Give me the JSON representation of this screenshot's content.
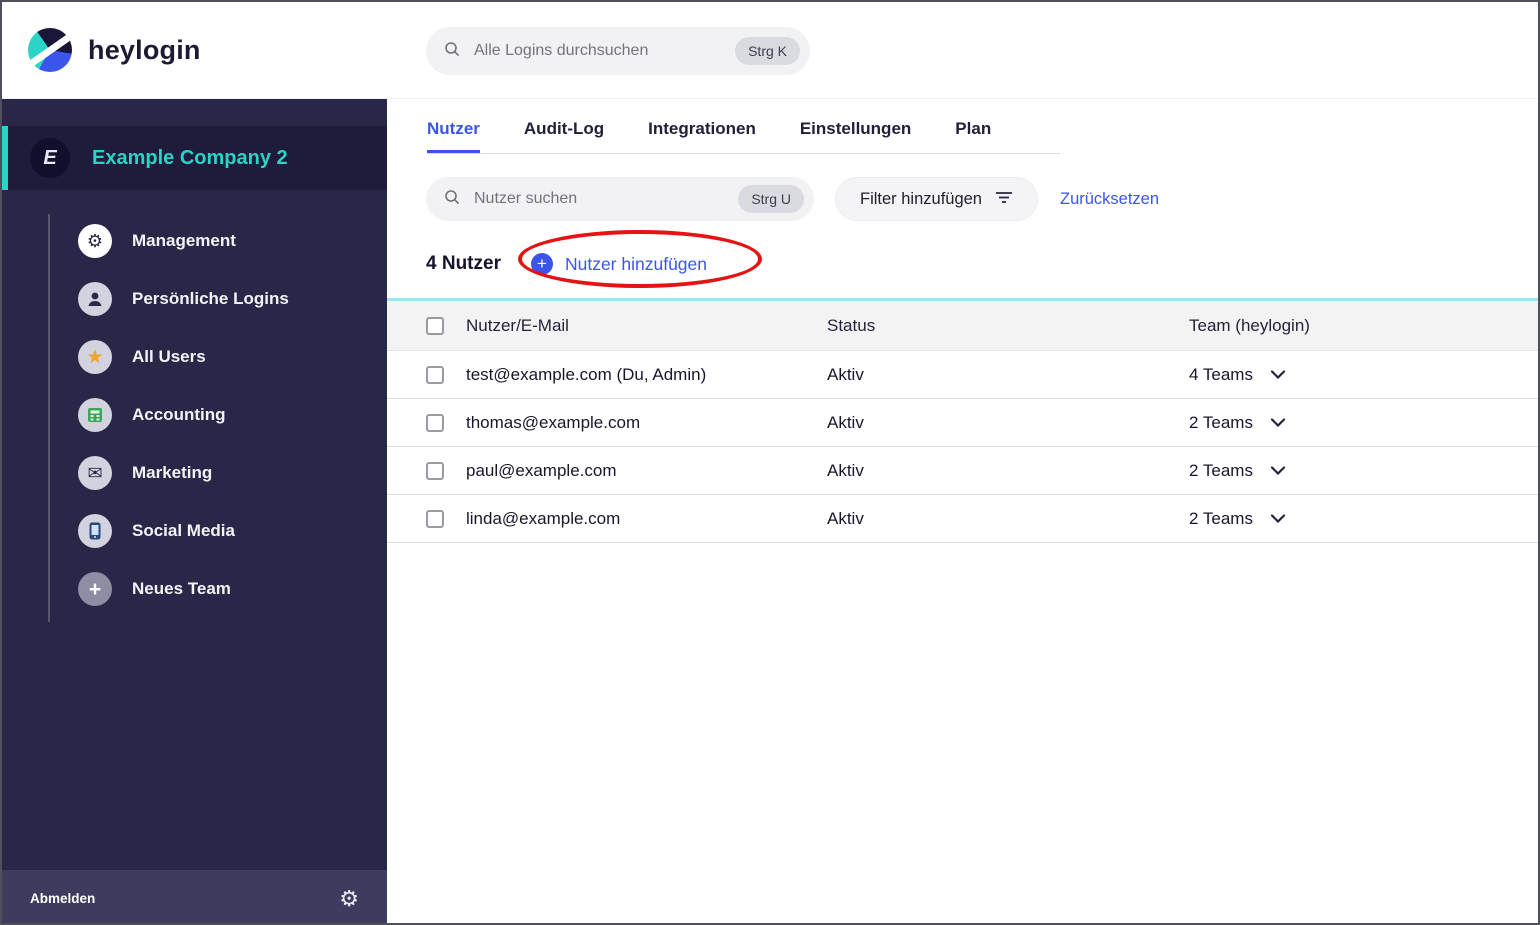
{
  "topbar": {
    "brand": "heylogin",
    "search": {
      "placeholder": "Alle Logins durchsuchen",
      "shortcut": "Strg K"
    }
  },
  "sidebar": {
    "company_name": "Example Company 2",
    "company_initial": "E",
    "items": [
      {
        "label": "Management"
      },
      {
        "label": "Persönliche Logins"
      },
      {
        "label": "All Users"
      },
      {
        "label": "Accounting"
      },
      {
        "label": "Marketing"
      },
      {
        "label": "Social Media"
      },
      {
        "label": "Neues Team"
      }
    ],
    "logout_label": "Abmelden"
  },
  "main": {
    "tabs": [
      {
        "label": "Nutzer"
      },
      {
        "label": "Audit-Log"
      },
      {
        "label": "Integrationen"
      },
      {
        "label": "Einstellungen"
      },
      {
        "label": "Plan"
      }
    ],
    "search": {
      "placeholder": "Nutzer suchen",
      "shortcut": "Strg U"
    },
    "filter_label": "Filter hinzufügen",
    "reset_label": "Zurücksetzen",
    "count_label": "4 Nutzer",
    "add_user_label": "Nutzer hinzufügen",
    "table": {
      "columns": {
        "email": "Nutzer/E-Mail",
        "status": "Status",
        "team": "Team (heylogin)"
      },
      "rows": [
        {
          "email": "test@example.com (Du, Admin)",
          "status": "Aktiv",
          "teams": "4 Teams"
        },
        {
          "email": "thomas@example.com",
          "status": "Aktiv",
          "teams": "2 Teams"
        },
        {
          "email": "paul@example.com",
          "status": "Aktiv",
          "teams": "2 Teams"
        },
        {
          "email": "linda@example.com",
          "status": "Aktiv",
          "teams": "2 Teams"
        }
      ]
    }
  },
  "colors": {
    "accent_teal": "#2bd3c6",
    "link_blue": "#3b55ec",
    "annotation_red": "#e41414",
    "sidebar_bg": "#292747"
  }
}
